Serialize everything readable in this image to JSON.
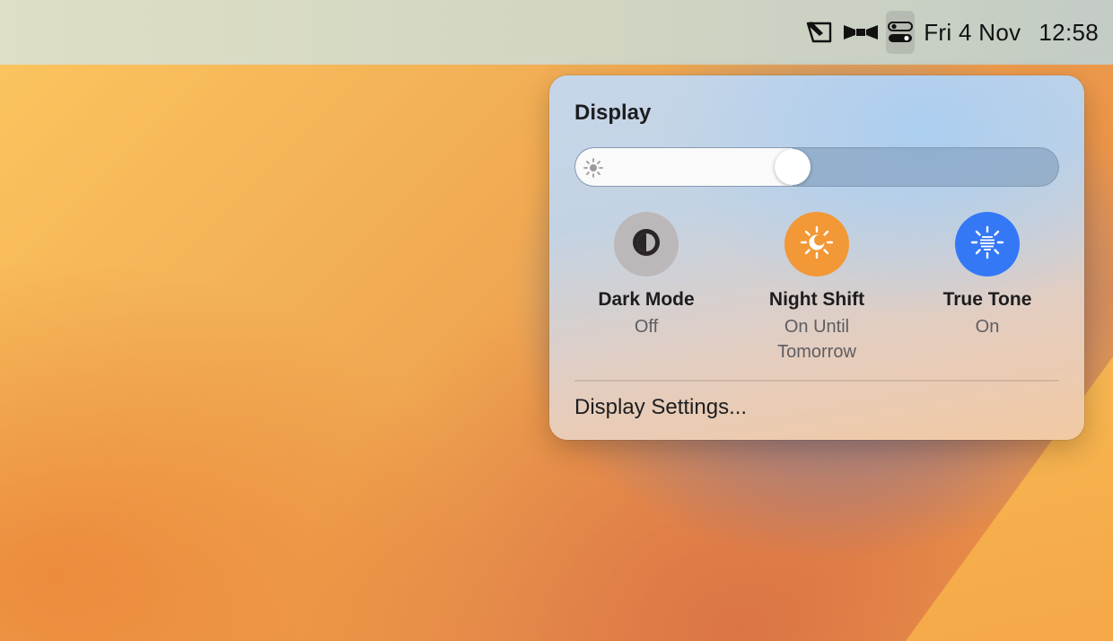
{
  "menubar": {
    "icons": [
      "pen-window-icon",
      "bowtie-icon",
      "control-center-icon"
    ],
    "date": "Fri 4 Nov",
    "time": "12:58"
  },
  "display_panel": {
    "title": "Display",
    "brightness": {
      "icon": "sun-icon",
      "level": 0.45
    },
    "tiles": [
      {
        "icon": "dark-mode-icon",
        "label": "Dark Mode",
        "status": "Off",
        "color": "#bcb7b9"
      },
      {
        "icon": "night-shift-icon",
        "label": "Night Shift",
        "status": "On Until Tomorrow",
        "color": "#f29836"
      },
      {
        "icon": "true-tone-icon",
        "label": "True Tone",
        "status": "On",
        "color": "#3478f6"
      }
    ],
    "settings_label": "Display Settings..."
  }
}
